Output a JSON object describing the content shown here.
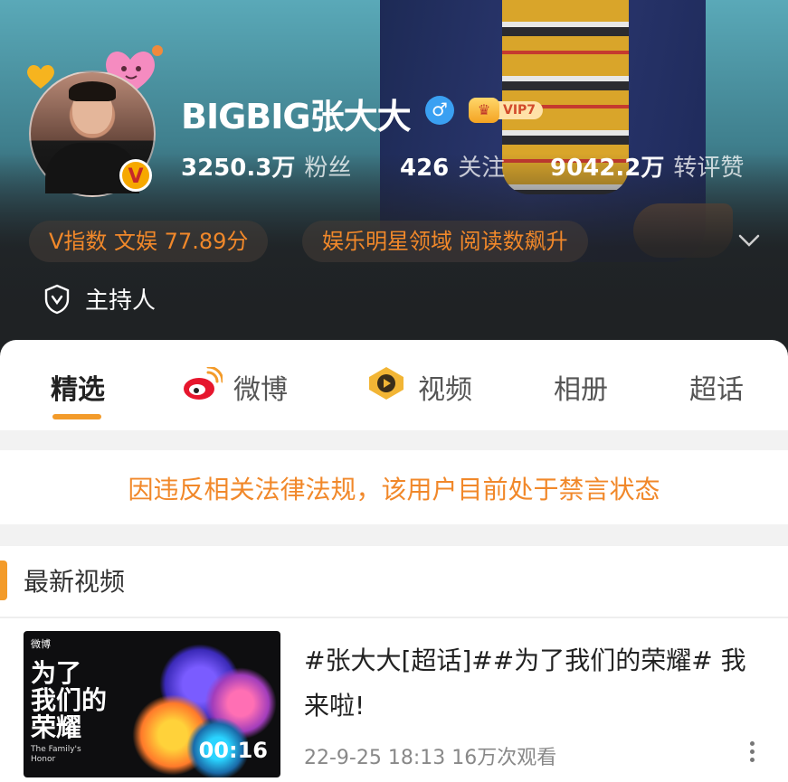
{
  "profile": {
    "name": "BIGBIG张大大",
    "gender_symbol": "♂",
    "vip_label": "VIP7",
    "verified_badge": "V",
    "stats": [
      {
        "value": "3250.3万",
        "label": "粉丝"
      },
      {
        "value": "426",
        "label": "关注"
      },
      {
        "value": "9042.2万",
        "label": "转评赞"
      }
    ],
    "pills": [
      "V指数 文娱 77.89分",
      "娱乐明星领域 阅读数飙升"
    ],
    "role_label": "主持人"
  },
  "tabs": [
    {
      "label": "精选",
      "active": true
    },
    {
      "label": "微博",
      "icon": "weibo-icon"
    },
    {
      "label": "视频",
      "icon": "video-play-icon"
    },
    {
      "label": "相册"
    },
    {
      "label": "超话"
    }
  ],
  "notice": "因违反相关法律法规，该用户目前处于禁言状态",
  "section": {
    "title": "最新视频",
    "video": {
      "thumb_logo": "微博",
      "thumb_title_line1": "为了",
      "thumb_title_line2": "我们的",
      "thumb_title_line3": "荣耀",
      "thumb_sub": "The Family's Honor",
      "duration": "00:16",
      "title": "#张大大[超话]##为了我们的荣耀# 我来啦!",
      "meta": "22-9-25 18:13 16万次观看"
    }
  },
  "colors": {
    "accent": "#f39b2a",
    "notice": "#f1882a",
    "gender": "#3aa0f2"
  }
}
